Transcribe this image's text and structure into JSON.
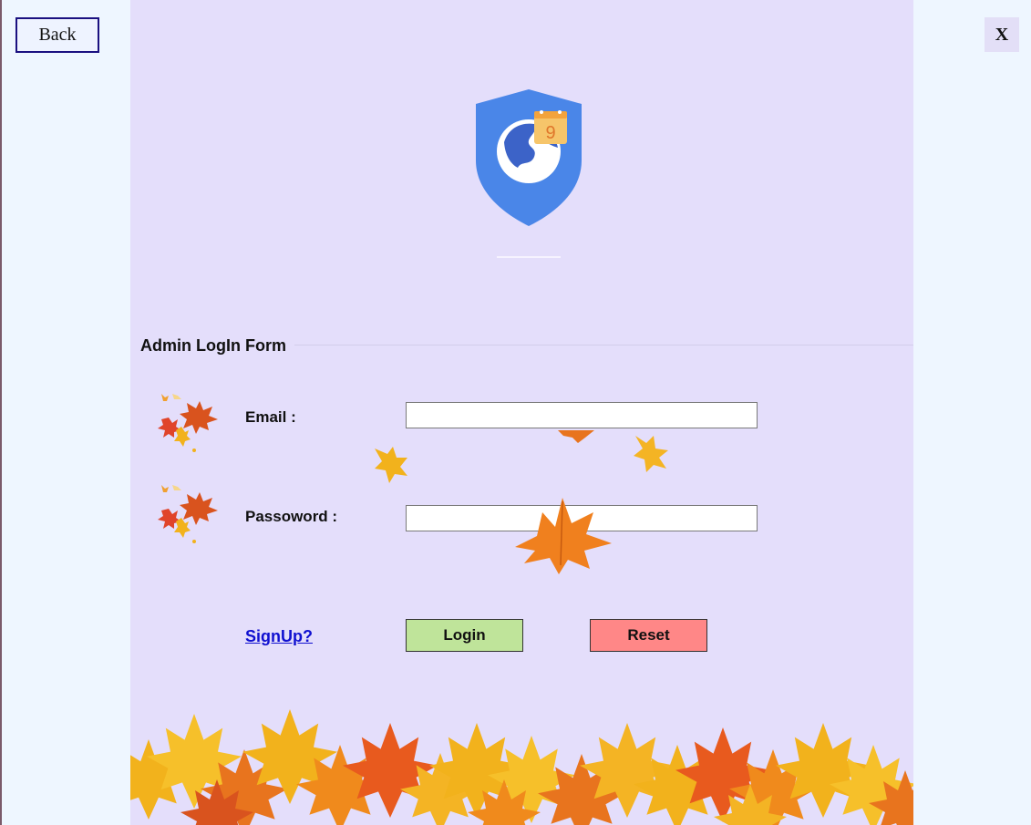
{
  "window": {
    "back_label": "Back",
    "close_label": "X"
  },
  "form": {
    "title": "Admin LogIn Form",
    "email_label": "Email :",
    "email_value": "",
    "password_label": "Passoword :",
    "password_value": "",
    "signup_label": "SignUp?",
    "login_label": "Login",
    "reset_label": "Reset"
  },
  "logo": {
    "badge_number": "9",
    "icon": "shield-globe-calendar-icon"
  },
  "colors": {
    "panel_bg": "#e4defb",
    "shield": "#4a86e8",
    "login_button": "#bfe49a",
    "reset_button": "#ff8787",
    "link": "#1010d0"
  }
}
